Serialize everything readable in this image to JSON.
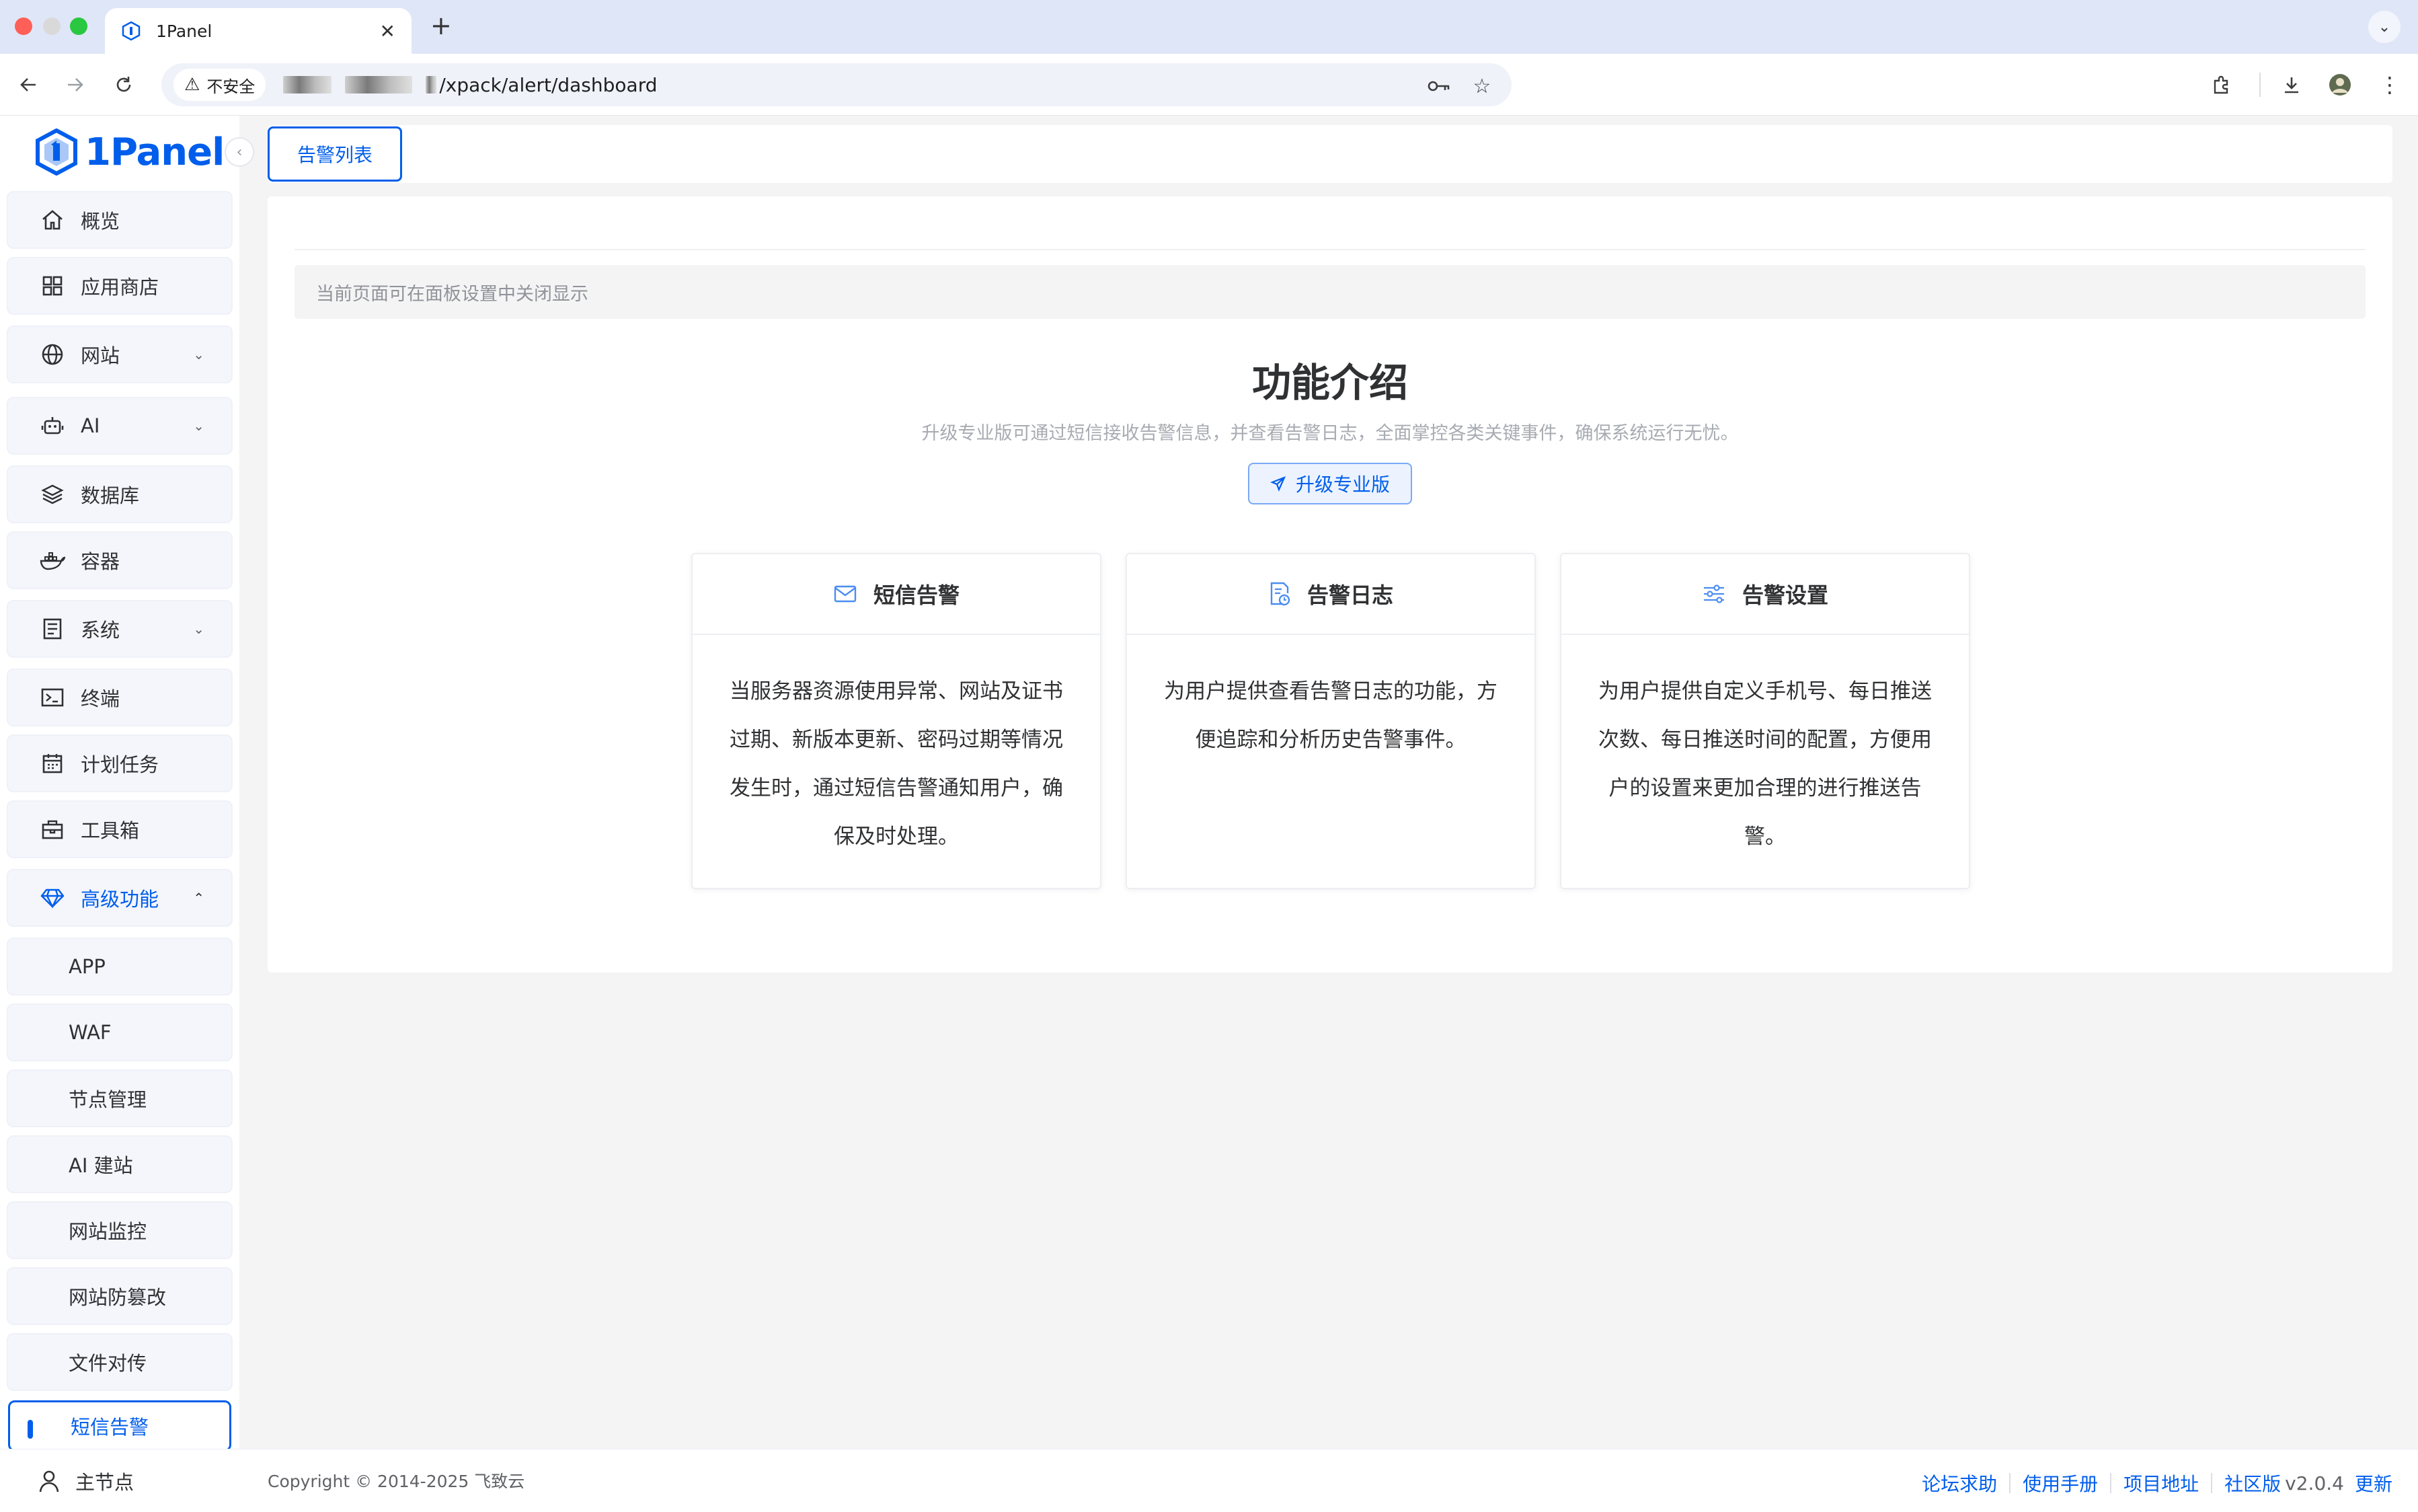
{
  "browser": {
    "tab_title": "1Panel",
    "security_label": "不安全",
    "url_path": "/xpack/alert/dashboard"
  },
  "sidebar": {
    "logo_text": "1Panel",
    "items": [
      {
        "label": "概览"
      },
      {
        "label": "应用商店"
      },
      {
        "label": "网站"
      },
      {
        "label": "AI"
      },
      {
        "label": "数据库"
      },
      {
        "label": "容器"
      },
      {
        "label": "系统"
      },
      {
        "label": "终端"
      },
      {
        "label": "计划任务"
      },
      {
        "label": "工具箱"
      },
      {
        "label": "高级功能"
      }
    ],
    "subitems": [
      {
        "label": "APP"
      },
      {
        "label": "WAF"
      },
      {
        "label": "节点管理"
      },
      {
        "label": "AI 建站"
      },
      {
        "label": "网站监控"
      },
      {
        "label": "网站防篡改"
      },
      {
        "label": "文件对传"
      },
      {
        "label": "短信告警"
      }
    ],
    "node_label": "主节点"
  },
  "main": {
    "tab_label": "告警列表",
    "notice": "当前页面可在面板设置中关闭显示",
    "intro_title": "功能介绍",
    "intro_desc": "升级专业版可通过短信接收告警信息，并查看告警日志，全面掌控各类关键事件，确保系统运行无忧。",
    "upgrade_label": "升级专业版",
    "cards": [
      {
        "title": "短信告警",
        "body": "当服务器资源使用异常、网站及证书过期、新版本更新、密码过期等情况发生时，通过短信告警通知用户，确保及时处理。"
      },
      {
        "title": "告警日志",
        "body": "为用户提供查看告警日志的功能，方便追踪和分析历史告警事件。"
      },
      {
        "title": "告警设置",
        "body": "为用户提供自定义手机号、每日推送次数、每日推送时间的配置，方便用户的设置来更加合理的进行推送告警。"
      }
    ]
  },
  "footer": {
    "copyright": "Copyright © 2014-2025 飞致云",
    "links": [
      "论坛求助",
      "使用手册",
      "项目地址",
      "社区版"
    ],
    "version": "v2.0.4",
    "update_label": "更新"
  },
  "colors": {
    "accent": "#005eeb",
    "bg": "#f4f4f5"
  }
}
